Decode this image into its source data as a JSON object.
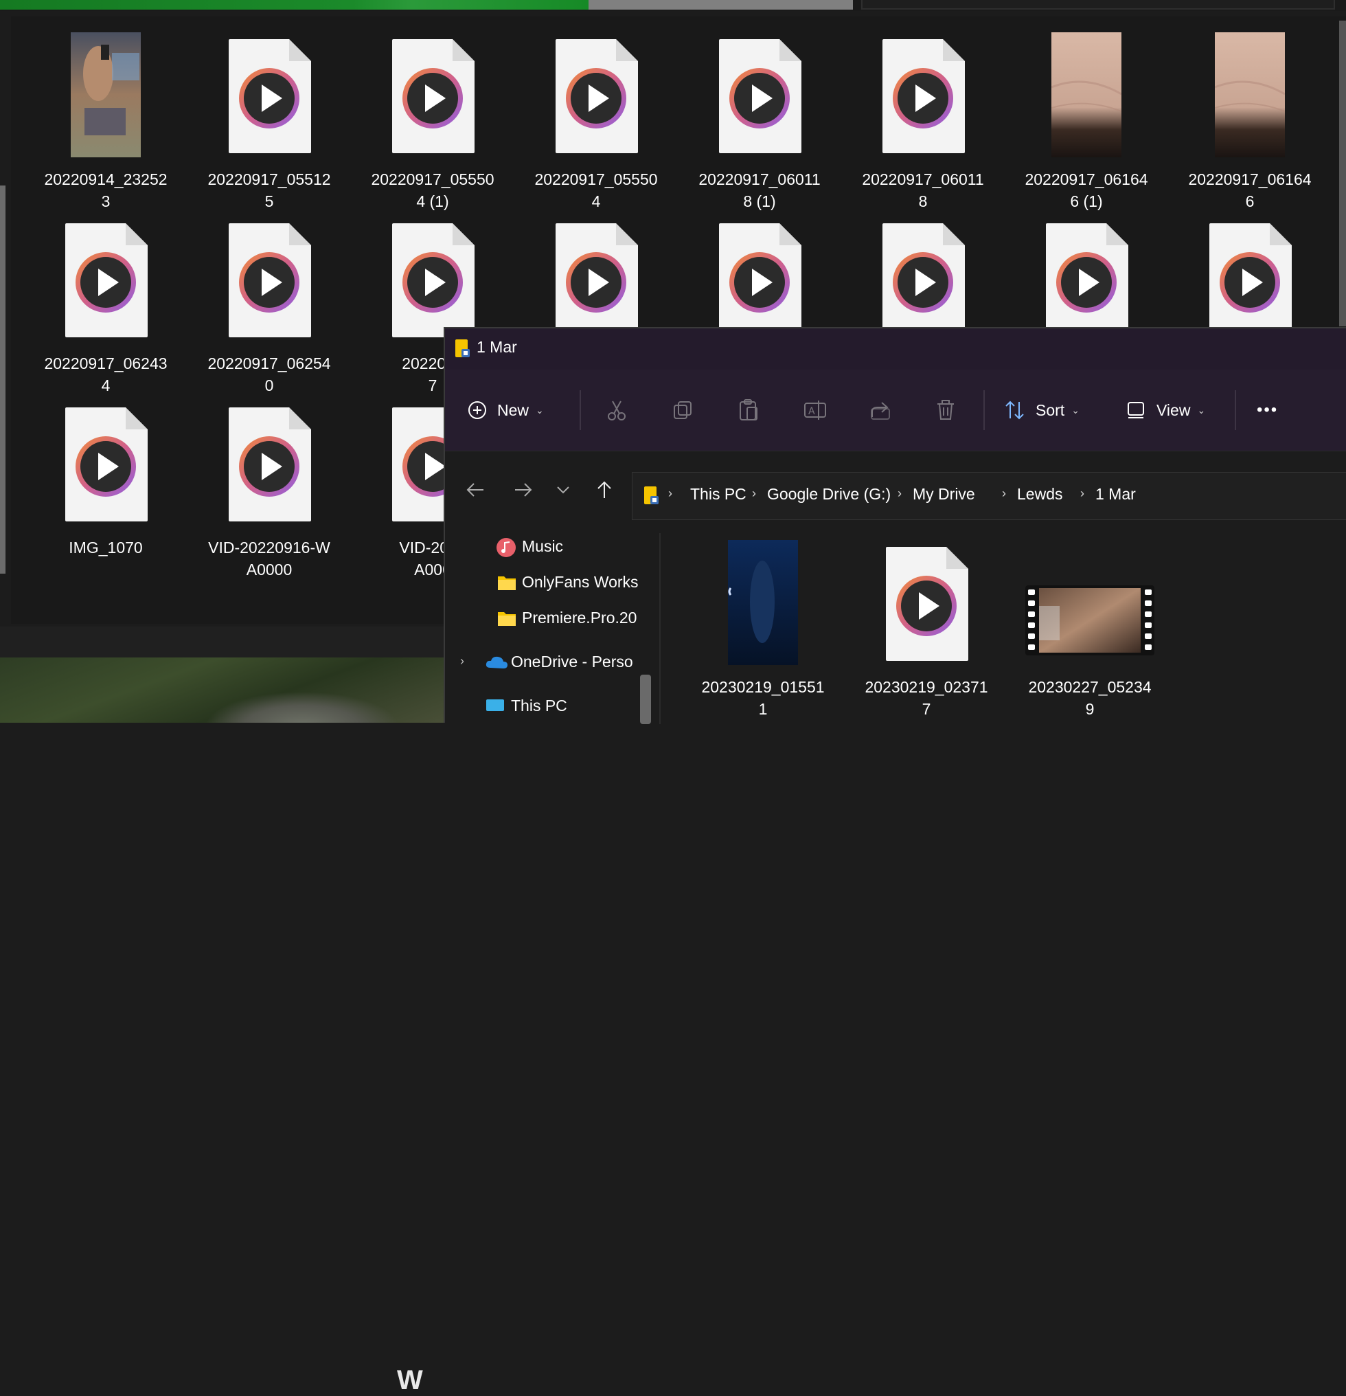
{
  "background_window": {
    "progress": {
      "fraction": 0.69
    },
    "files": [
      {
        "name": "20220914_232523",
        "line1": "20220914_23252",
        "line2": "3",
        "thumb": "photo-people"
      },
      {
        "name": "20220917_055125",
        "line1": "20220917_05512",
        "line2": "5",
        "thumb": "video-file-icon"
      },
      {
        "name": "20220917_055504 (1)",
        "line1": "20220917_05550",
        "line2": "4 (1)",
        "thumb": "video-file-icon"
      },
      {
        "name": "20220917_055504",
        "line1": "20220917_05550",
        "line2": "4",
        "thumb": "video-file-icon"
      },
      {
        "name": "20220917_060118 (1)",
        "line1": "20220917_06011",
        "line2": "8 (1)",
        "thumb": "video-file-icon"
      },
      {
        "name": "20220917_060118",
        "line1": "20220917_06011",
        "line2": "8",
        "thumb": "video-file-icon"
      },
      {
        "name": "20220917_061646 (1)",
        "line1": "20220917_06164",
        "line2": "6 (1)",
        "thumb": "photo-skin"
      },
      {
        "name": "20220917_061646",
        "line1": "20220917_06164",
        "line2": "6",
        "thumb": "photo-skin"
      },
      {
        "name": "20220917_062434",
        "line1": "20220917_06243",
        "line2": "4",
        "thumb": "video-file-icon"
      },
      {
        "name": "20220917_062540",
        "line1": "20220917_06254",
        "line2": "0",
        "thumb": "video-file-icon"
      },
      {
        "name": "2022092…7",
        "line1": "2022092",
        "line2": "7",
        "thumb": "video-file-icon"
      },
      {
        "name": "",
        "line1": "",
        "line2": "",
        "thumb": "video-file-icon"
      },
      {
        "name": "",
        "line1": "",
        "line2": "",
        "thumb": "video-file-icon"
      },
      {
        "name": "",
        "line1": "",
        "line2": "",
        "thumb": "video-file-icon"
      },
      {
        "name": "",
        "line1": "",
        "line2": "",
        "thumb": "video-file-icon"
      },
      {
        "name": "",
        "line1": "",
        "line2": "",
        "thumb": "video-file-icon"
      },
      {
        "name": "IMG_1070",
        "line1": "IMG_1070",
        "line2": "",
        "thumb": "video-file-icon"
      },
      {
        "name": "VID-20220916-WA0000",
        "line1": "VID-20220916-W",
        "line2": "A0000",
        "thumb": "video-file-icon"
      },
      {
        "name": "VID-2022…A000",
        "line1": "VID-2022",
        "line2": "A000",
        "thumb": "video-file-icon"
      }
    ],
    "wallpaper_text": "W"
  },
  "explorer": {
    "title": "1 Mar",
    "toolbar": {
      "new_label": "New",
      "sort_label": "Sort",
      "view_label": "View",
      "more_label": "•••"
    },
    "breadcrumb": [
      "This PC",
      "Google Drive (G:)",
      "My Drive",
      "Lewds",
      "1 Mar"
    ],
    "sidebar": [
      {
        "label": "Music",
        "icon": "music-icon"
      },
      {
        "label": "OnlyFans Works",
        "icon": "folder-icon"
      },
      {
        "label": "Premiere.Pro.20",
        "icon": "folder-icon"
      },
      {
        "label": "OneDrive - Perso",
        "icon": "onedrive-cloud-icon"
      },
      {
        "label": "This PC",
        "icon": "this-pc-icon"
      }
    ],
    "files": [
      {
        "line1": "20230219_01551",
        "line2": "1",
        "thumb": "photo-dark-blue"
      },
      {
        "line1": "20230219_02371",
        "line2": "7",
        "thumb": "video-file-icon"
      },
      {
        "line1": "20230227_05234",
        "line2": "9",
        "thumb": "film-strip-thumbnail"
      }
    ]
  },
  "colors": {
    "accent_orange": "#f07b3f",
    "accent_purple": "#9b5de5",
    "titlebar": "#241b2c",
    "folder_yellow": "#f5c400"
  }
}
